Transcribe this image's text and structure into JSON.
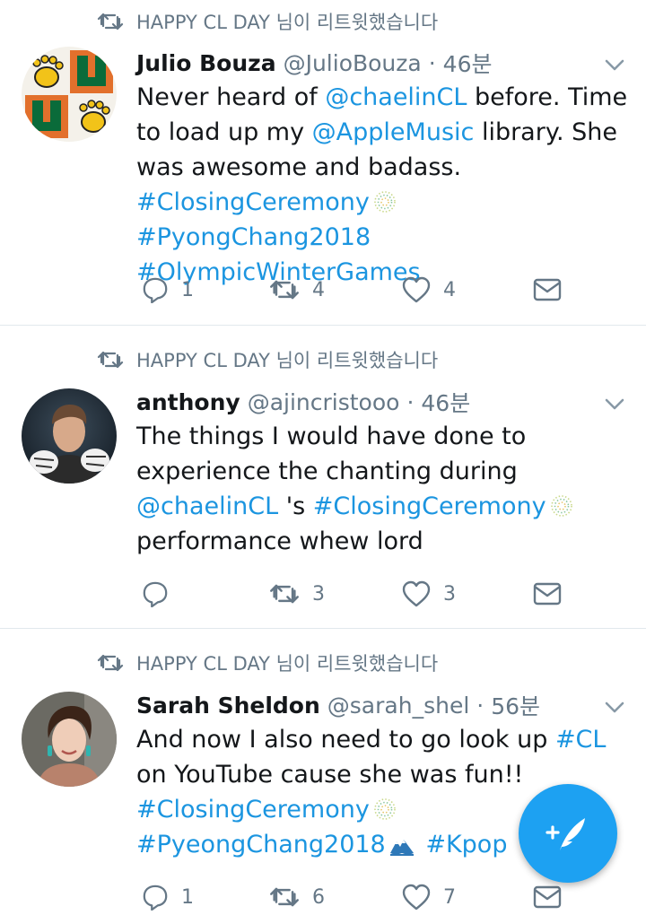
{
  "retweet_banner": "HAPPY CL DAY 님이 리트윗했습니다",
  "tweets": [
    {
      "name": "Julio Bouza",
      "handle": "@JulioBouza",
      "dot": "·",
      "time": "46분",
      "text": {
        "t1": "Never heard of ",
        "m1": "@chaelinCL",
        "t2": " before.  Time to load up my ",
        "m2": "@AppleMusic",
        "t3": " library.  She was awesome and badass.",
        "h1": "#ClosingCeremony",
        "h2": "#PyongChang2018",
        "h3": "#OlympicWinterGames"
      },
      "replies": "1",
      "retweets": "4",
      "likes": "4"
    },
    {
      "name": "anthony",
      "handle": "@ajincristooo",
      "dot": "·",
      "time": "46분",
      "text": {
        "t1": "The things I would have done to experience the chanting during ",
        "m1": "@chaelinCL",
        "t2": " 's ",
        "h1": "#ClosingCeremony",
        "t3": " performance whew lord"
      },
      "replies": "",
      "retweets": "3",
      "likes": "3"
    },
    {
      "name": "Sarah Sheldon",
      "handle": "@sarah_shel",
      "dot": "·",
      "time": "56분",
      "text": {
        "t1": "And now I also need to go look up ",
        "h1": "#CL",
        "t2": " on YouTube cause she was fun!!",
        "h2": "#ClosingCeremony",
        "h3": "#PyeongChang2018",
        "h4": "#Kpop"
      },
      "replies": "1",
      "retweets": "6",
      "likes": "7"
    }
  ],
  "colors": {
    "link": "#1b95e0",
    "muted": "#657786",
    "fab": "#1da1f2",
    "separator": "#e1e8ed"
  },
  "icons": [
    "retweet-icon",
    "reply-icon",
    "like-icon",
    "direct-message-icon",
    "chevron-down-icon",
    "compose-tweet-icon"
  ]
}
